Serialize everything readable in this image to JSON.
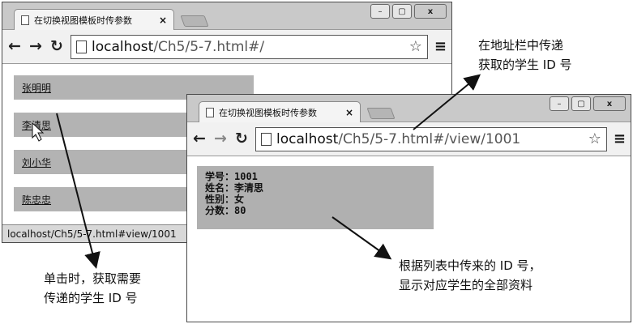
{
  "tab_title": "在切换视图模板时传参数",
  "tab_close": "×",
  "window_buttons": {
    "minimize": "–",
    "maximize": "▢",
    "close": "x"
  },
  "nav": {
    "back": "←",
    "forward": "→",
    "reload": "↻",
    "menu": "≡",
    "star": "☆"
  },
  "window1": {
    "url_host": "localhost",
    "url_path": "/Ch5/5-7.html#/",
    "students": [
      "张明明",
      "李清思",
      "刘小华",
      "陈忠忠"
    ],
    "status_text": "localhost/Ch5/5-7.html#view/1001"
  },
  "window2": {
    "url_host": "localhost",
    "url_path": "/Ch5/5-7.html#/view/1001",
    "detail": {
      "id_line": "学号：1001",
      "name_line": "姓名：李清思",
      "gender_line": "性别：女",
      "score_line": "分数：80"
    }
  },
  "annotations": {
    "top_line1": "在地址栏中传递",
    "top_line2": "获取的学生 ID 号",
    "bottom_left_line1": "单击时，获取需要",
    "bottom_left_line2": "传递的学生 ID 号",
    "bottom_right_line1": "根据列表中传来的 ID 号，",
    "bottom_right_line2": "显示对应学生的全部资料"
  }
}
